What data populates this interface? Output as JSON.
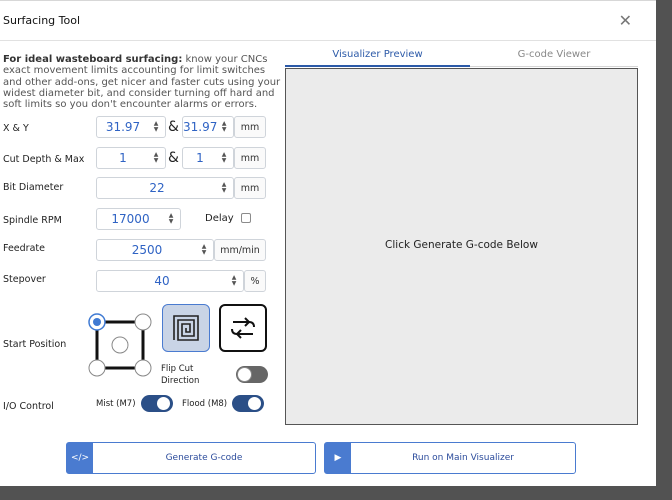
{
  "dialog": {
    "title": "Surfacing Tool",
    "close_icon": "close-icon"
  },
  "intro": {
    "bold": "For ideal wasteboard surfacing:",
    "text": " know your CNCs exact movement limits accounting for limit switches and other add-ons, get nicer and faster cuts using your widest diameter bit, and consider turning off hard and soft limits so you don't encounter alarms or errors."
  },
  "form": {
    "xy": {
      "label": "X & Y",
      "x": "31.97",
      "y": "31.97",
      "amp": "&",
      "unit": "mm"
    },
    "depth": {
      "label": "Cut Depth & Max",
      "depth": "1",
      "max": "1",
      "amp": "&",
      "unit": "mm"
    },
    "bit": {
      "label": "Bit Diameter",
      "value": "22",
      "unit": "mm"
    },
    "rpm": {
      "label": "Spindle RPM",
      "value": "17000",
      "delay_label": "Delay",
      "delay_checked": false
    },
    "feedrate": {
      "label": "Feedrate",
      "value": "2500",
      "unit": "mm/min"
    },
    "stepover": {
      "label": "Stepover",
      "value": "40",
      "unit": "%"
    },
    "start": {
      "label": "Start Position",
      "selected_corner": "top-left"
    },
    "pattern": {
      "spiral_icon": "spiral-icon",
      "zigzag_icon": "zigzag-icon",
      "selected": "spiral"
    },
    "flip": {
      "label_line1": "Flip Cut",
      "label_line2": "Direction",
      "enabled": false
    },
    "io": {
      "label": "I/O Control",
      "mist_label": "Mist (M7)",
      "mist_on": true,
      "flood_label": "Flood (M8)",
      "flood_on": true
    }
  },
  "tabs": [
    {
      "label": "Visualizer Preview",
      "active": true
    },
    {
      "label": "G-code Viewer",
      "active": false
    }
  ],
  "preview": {
    "placeholder": "Click Generate G-code Below"
  },
  "buttons": {
    "generate": {
      "label": "Generate G-code",
      "icon": "code-icon"
    },
    "run": {
      "label": "Run on Main Visualizer",
      "icon": "play-icon"
    }
  },
  "colors": {
    "accent": "#4a7bd0",
    "value_text": "#2f63c4",
    "toggle_on": "#2b4f87",
    "toggle_off": "#666666"
  }
}
